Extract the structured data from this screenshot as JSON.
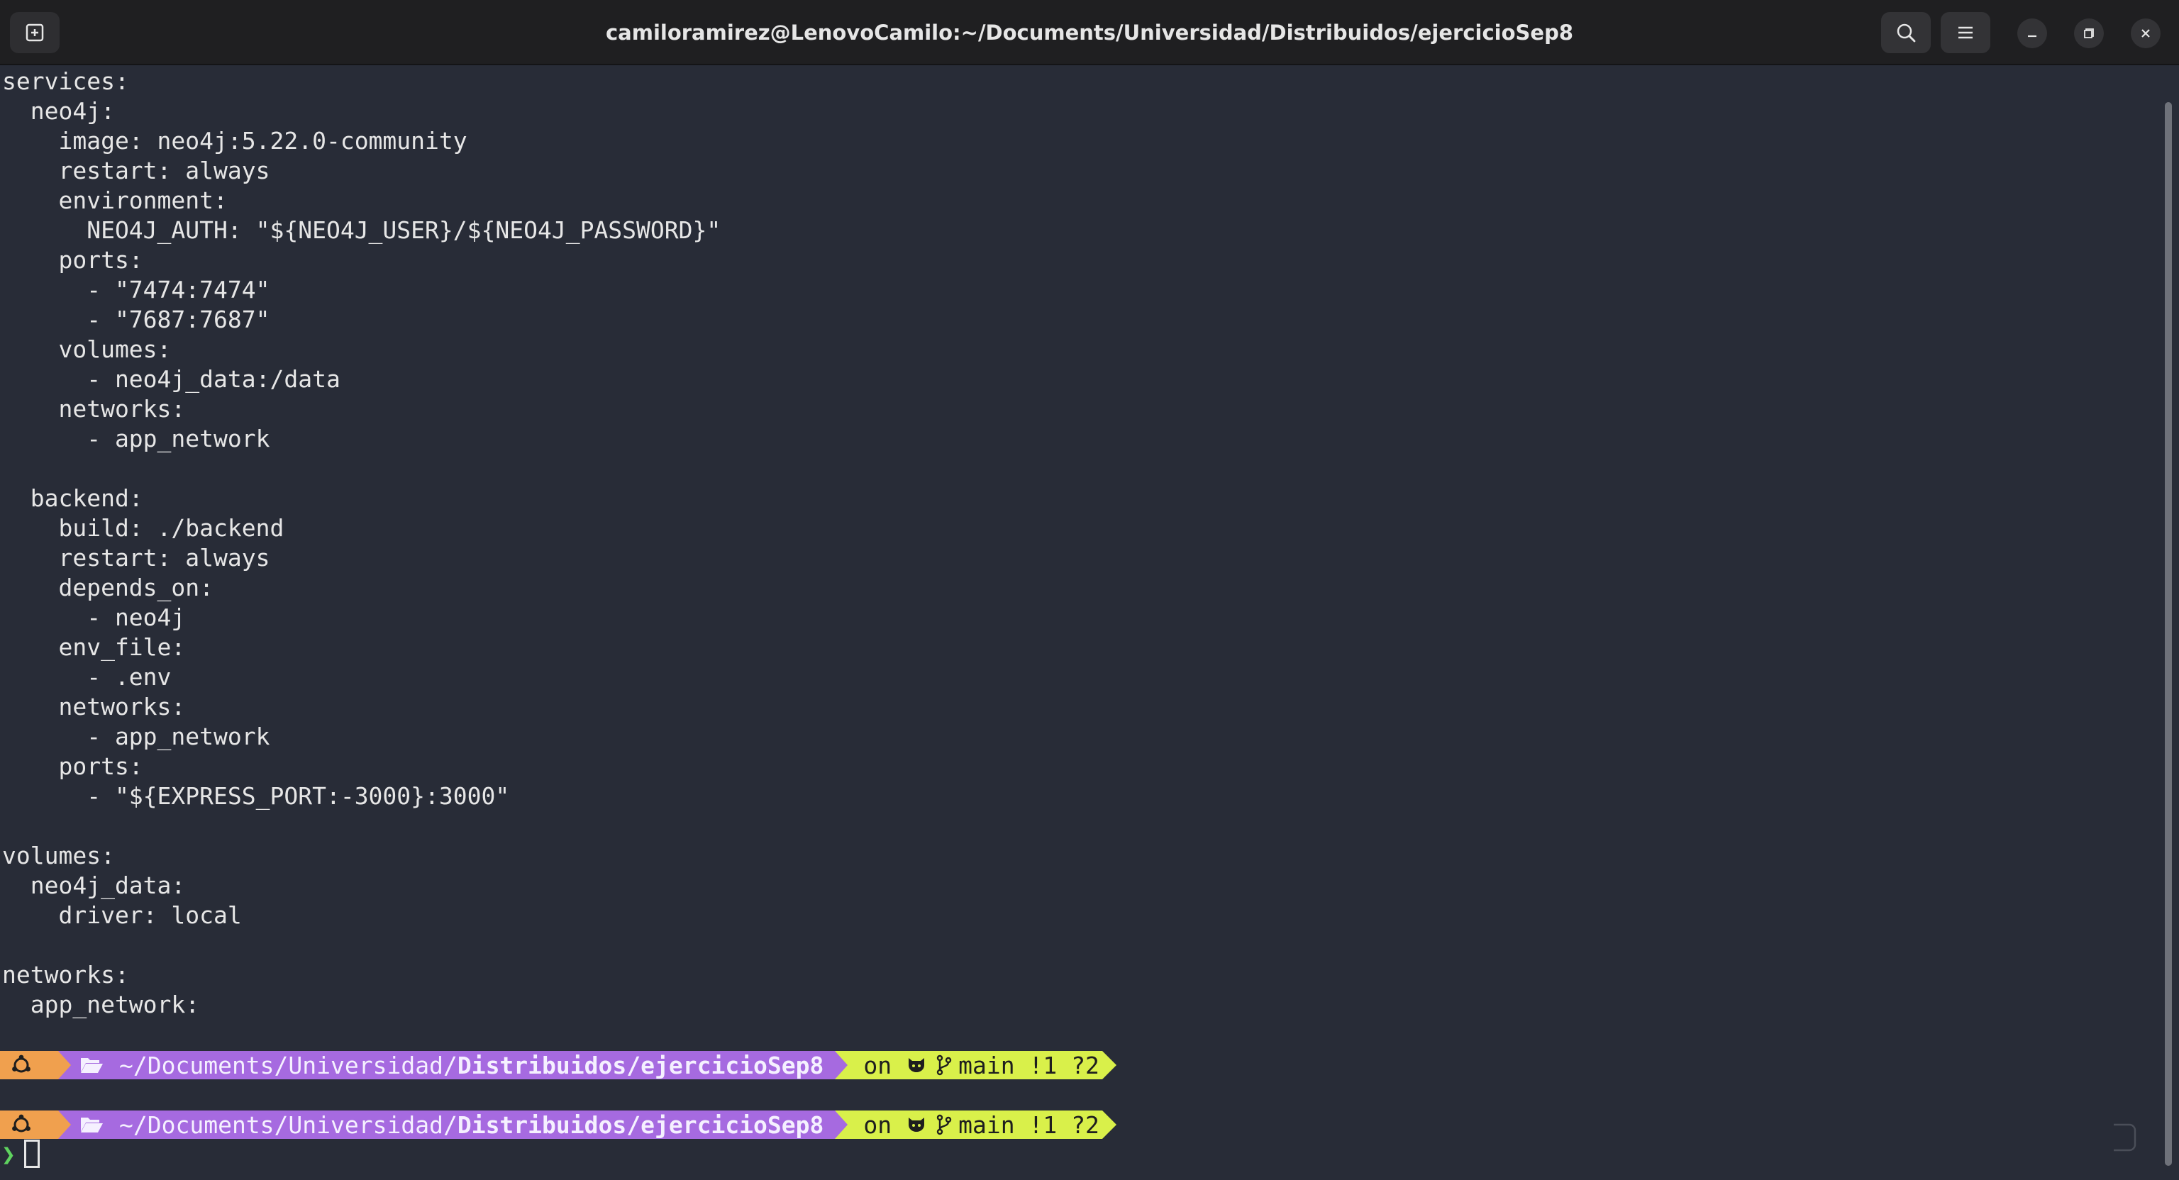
{
  "window": {
    "title": "camiloramirez@LenovoCamilo:~/Documents/Universidad/Distribuidos/ejercicioSep8",
    "icons": {
      "new_tab": "new-tab-icon",
      "search": "search-icon",
      "menu": "hamburger-icon",
      "minimize": "minimize-icon",
      "maximize": "maximize-icon",
      "close": "close-icon"
    }
  },
  "terminal": {
    "lines": [
      "services:",
      "  neo4j:",
      "    image: neo4j:5.22.0-community",
      "    restart: always",
      "    environment:",
      "      NEO4J_AUTH: \"${NEO4J_USER}/${NEO4J_PASSWORD}\"",
      "    ports:",
      "      - \"7474:7474\"",
      "      - \"7687:7687\"",
      "    volumes:",
      "      - neo4j_data:/data",
      "    networks:",
      "      - app_network",
      "",
      "  backend:",
      "    build: ./backend",
      "    restart: always",
      "    depends_on:",
      "      - neo4j",
      "    env_file:",
      "      - .env",
      "    networks:",
      "      - app_network",
      "    ports:",
      "      - \"${EXPRESS_PORT:-3000}:3000\"",
      "",
      "volumes:",
      "  neo4j_data:",
      "    driver: local",
      "",
      "networks:",
      "  app_network:"
    ],
    "prompts": [
      {
        "path_prefix": "~/Documents/Universidad/",
        "path_bold": "Distribuidos/ejercicioSep8",
        "git_on": "on",
        "git_branch": "main",
        "git_status": "!1 ?2"
      },
      {
        "path_prefix": "~/Documents/Universidad/",
        "path_bold": "Distribuidos/ejercicioSep8",
        "git_on": "on",
        "git_branch": "main",
        "git_status": "!1 ?2"
      }
    ],
    "input_prompt_symbol": "❯",
    "colors": {
      "background": "#282c37",
      "foreground": "#e6e6e6",
      "os_segment": "#f0a04e",
      "path_segment": "#a66ae0",
      "git_segment": "#d9f04a",
      "prompt_char": "#5fd35f"
    }
  }
}
